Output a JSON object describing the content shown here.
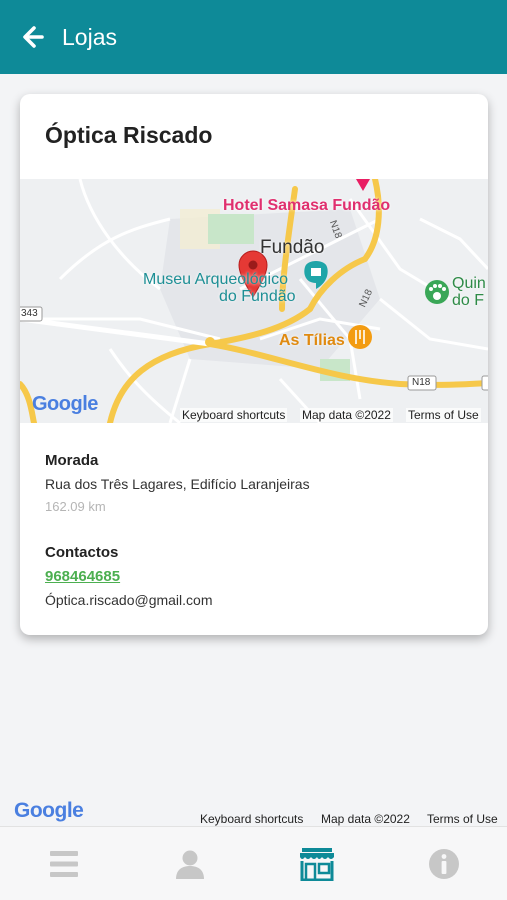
{
  "header": {
    "title": "Lojas",
    "back_icon": "arrow-left-icon"
  },
  "store": {
    "name": "Óptica Riscado",
    "address_label": "Morada",
    "address": "Rua dos Três Lagares, Edifício Laranjeiras",
    "distance": "162.09 km",
    "contacts_label": "Contactos",
    "phone": "968464685",
    "email": "Óptica.riscado@gmail.com"
  },
  "map": {
    "labels": {
      "hotel": "Hotel Samasa Fundão",
      "town": "Fundão",
      "museum_line1": "Museu Arqueológico",
      "museum_line2": "do Fundão",
      "restaurant": "As Tílias",
      "poi_right_line1": "Quin",
      "poi_right_line2": "do F",
      "road_n18_a": "N18",
      "road_n18_b": "N18",
      "road_n18_c": "N18",
      "road_343": "343"
    },
    "google_logo": "Google",
    "attribution": {
      "shortcuts": "Keyboard shortcuts",
      "data": "Map data ©2022",
      "terms": "Terms of Use"
    },
    "colors": {
      "marker": "#e53935",
      "major_road": "#f6c84a",
      "park": "#c8e6c9",
      "water_poi": "#1fa5a8",
      "restaurant_poi": "#f39c12",
      "hotel_poi": "#e91e63"
    }
  },
  "background_map": {
    "google_logo": "Google",
    "attribution": {
      "shortcuts": "Keyboard shortcuts",
      "data": "Map data ©2022",
      "terms": "Terms of Use"
    }
  },
  "tabbar": {
    "items": [
      {
        "icon": "menu-icon",
        "active": false
      },
      {
        "icon": "user-icon",
        "active": false
      },
      {
        "icon": "store-icon",
        "active": true
      },
      {
        "icon": "info-icon",
        "active": false
      }
    ],
    "colors": {
      "active": "#0e8a98",
      "inactive": "#c7c7c7"
    }
  }
}
